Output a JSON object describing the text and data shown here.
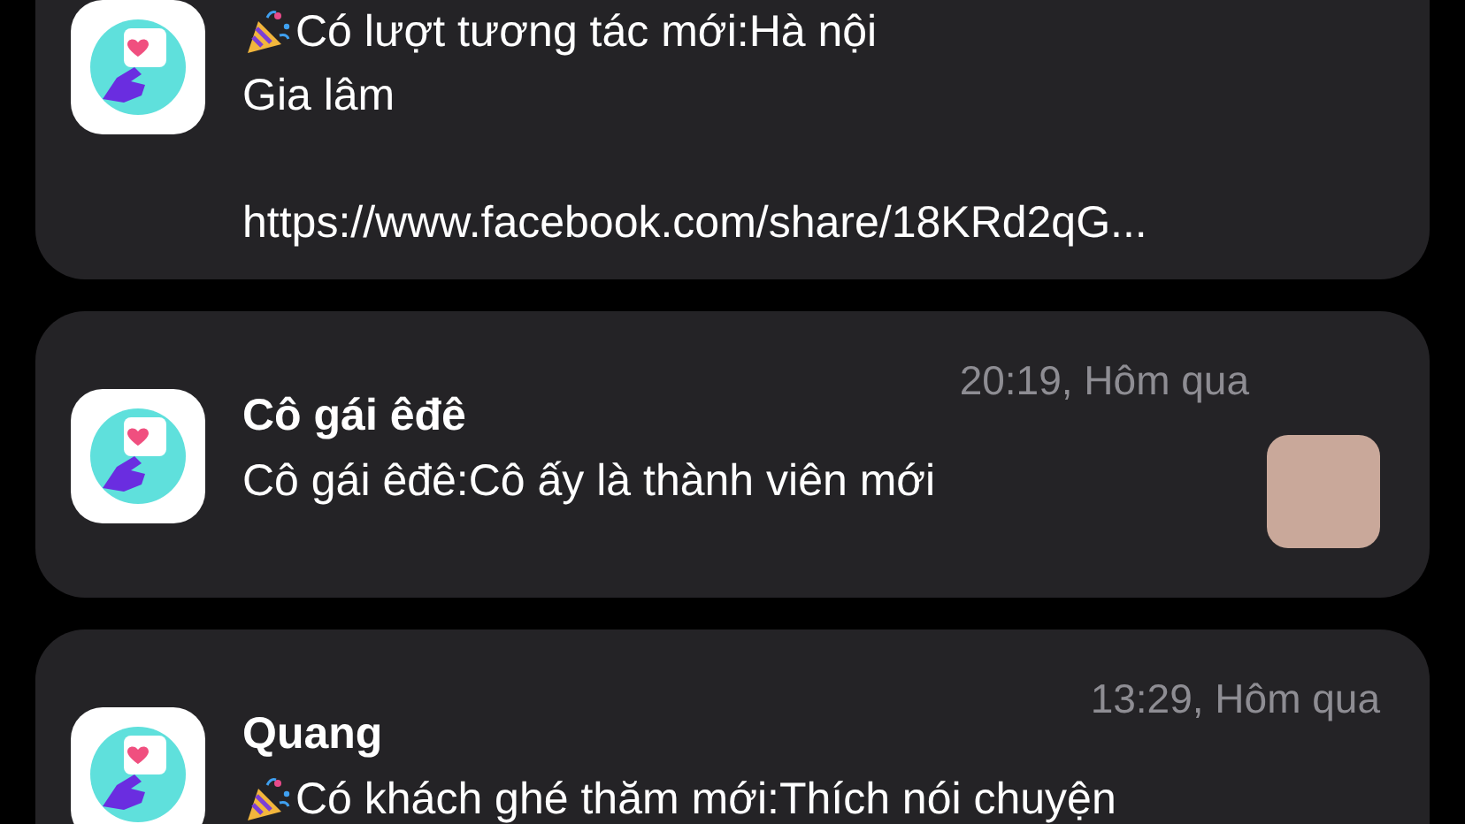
{
  "notifications": [
    {
      "lines": [
        "Có lượt tương tác mới:Hà nội",
        "Gia lâm"
      ],
      "link": "https://www.facebook.com/share/18KRd2qG...",
      "party": true,
      "thumbnail": false,
      "cut_top": true
    },
    {
      "title": "Cô gái êđê",
      "time": "20:19, Hôm qua",
      "lines": [
        "Cô gái êđê:Cô ấy là thành viên mới"
      ],
      "party": false,
      "thumbnail": true,
      "cut_top": false
    },
    {
      "title": "Quang",
      "time": "13:29, Hôm qua",
      "lines": [
        "Có khách ghé thăm mới:Thích nói chuyện"
      ],
      "party": true,
      "thumbnail": false,
      "cut_top": false
    }
  ]
}
